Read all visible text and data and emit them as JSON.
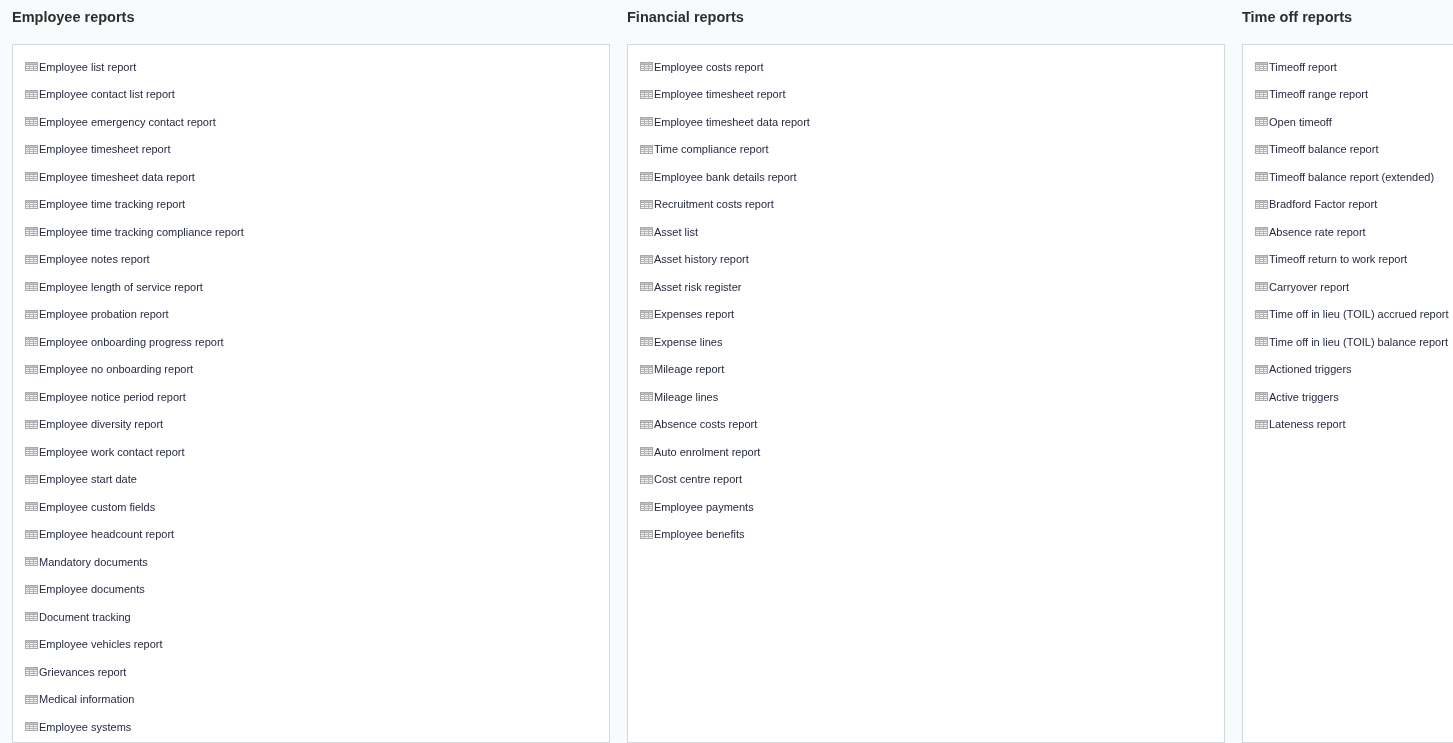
{
  "sections": [
    {
      "title": "Employee reports",
      "items": [
        "Employee list report",
        "Employee contact list report",
        "Employee emergency contact report",
        "Employee timesheet report",
        "Employee timesheet data report",
        "Employee time tracking report",
        "Employee time tracking compliance report",
        "Employee notes report",
        "Employee length of service report",
        "Employee probation report",
        "Employee onboarding progress report",
        "Employee no onboarding report",
        "Employee notice period report",
        "Employee diversity report",
        "Employee work contact report",
        "Employee start date",
        "Employee custom fields",
        "Employee headcount report",
        "Mandatory documents",
        "Employee documents",
        "Document tracking",
        "Employee vehicles report",
        "Grievances report",
        "Medical information",
        "Employee systems"
      ]
    },
    {
      "title": "Financial reports",
      "items": [
        "Employee costs report",
        "Employee timesheet report",
        "Employee timesheet data report",
        "Time compliance report",
        "Employee bank details report",
        "Recruitment costs report",
        "Asset list",
        "Asset history report",
        "Asset risk register",
        "Expenses report",
        "Expense lines",
        "Mileage report",
        "Mileage lines",
        "Absence costs report",
        "Auto enrolment report",
        "Cost centre report",
        "Employee payments",
        "Employee benefits"
      ]
    },
    {
      "title": "Time off reports",
      "items": [
        "Timeoff report",
        "Timeoff range report",
        "Open timeoff",
        "Timeoff balance report",
        "Timeoff balance report (extended)",
        "Bradford Factor report",
        "Absence rate report",
        "Timeoff return to work report",
        "Carryover report",
        "Time off in lieu (TOIL) accrued report",
        "Time off in lieu (TOIL) balance report",
        "Actioned triggers",
        "Active triggers",
        "Lateness report"
      ]
    }
  ]
}
